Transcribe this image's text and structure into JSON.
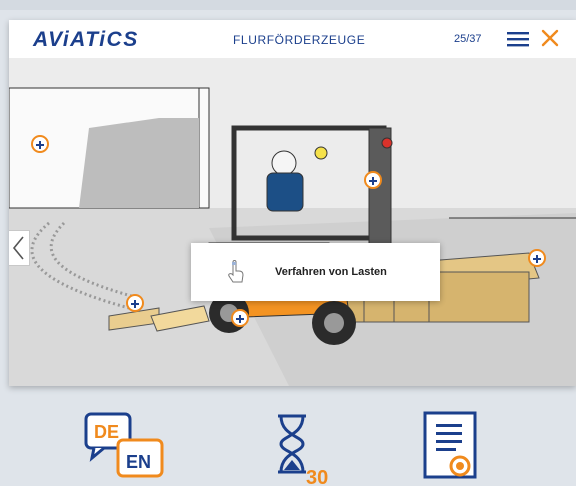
{
  "header": {
    "logo": "AViATiCS",
    "title": "FLURFÖRDERZEUGE",
    "counter": "25/37"
  },
  "tooltip": {
    "label": "Verfahren von Lasten"
  },
  "icons": {
    "menu": "hamburger-menu-icon",
    "close": "close-x-icon",
    "prev": "chevron-left-icon",
    "hotspot": "plus-circle-icon",
    "pointer": "hand-pointer-icon",
    "language": "language-switch-icon",
    "timer": "hourglass-icon",
    "certificate": "certificate-icon"
  },
  "bottom": {
    "lang_a": "DE",
    "lang_b": "EN",
    "timer_value": "30"
  },
  "colors": {
    "brand_blue": "#1b3f8c",
    "accent_orange": "#f08a1d"
  }
}
